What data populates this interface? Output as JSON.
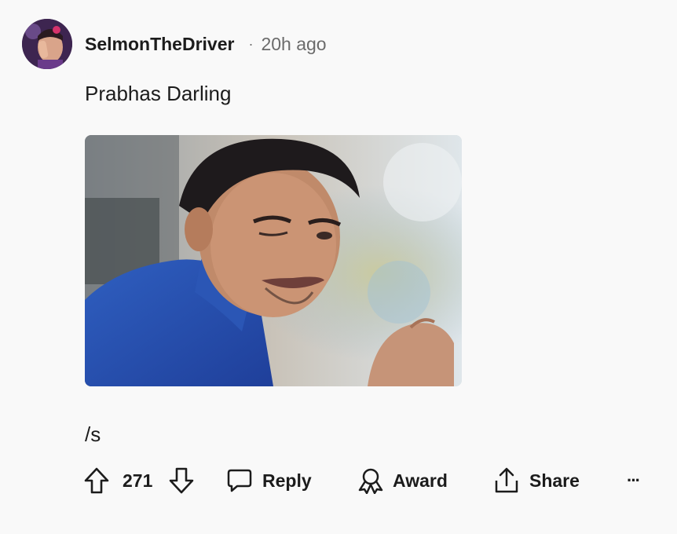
{
  "comment": {
    "username": "SelmonTheDriver",
    "separator": "·",
    "timestamp": "20h ago",
    "text": "Prabhas Darling",
    "trailing_text": "/s"
  },
  "actions": {
    "upvote_icon": "arrow-up-outline-icon",
    "score": "271",
    "downvote_icon": "arrow-down-outline-icon",
    "reply_label": "Reply",
    "reply_icon": "speech-bubble-icon",
    "award_label": "Award",
    "award_icon": "award-ribbon-icon",
    "share_label": "Share",
    "share_icon": "share-upload-icon",
    "more_label": "···"
  },
  "colors": {
    "background": "#f9f9f9",
    "text_primary": "#1c1c1c",
    "text_secondary": "#6b6b6b"
  }
}
